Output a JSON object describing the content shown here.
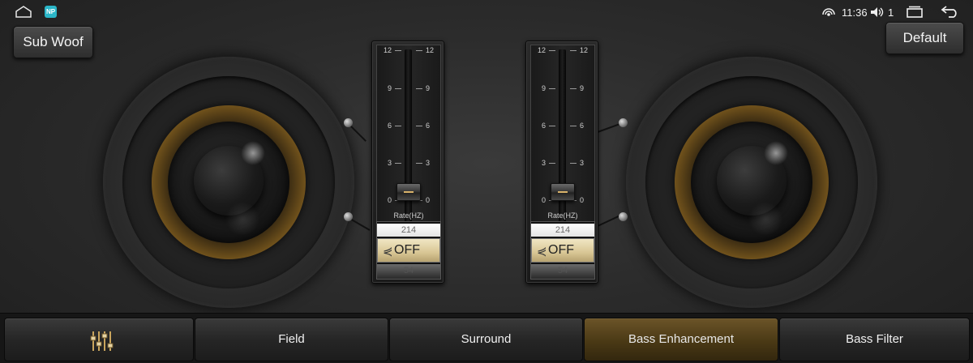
{
  "status_bar": {
    "time": "11:36",
    "volume_level": "1",
    "icons": [
      "home-icon",
      "app-icon",
      "hotspot-icon",
      "volume-icon",
      "recent-apps-icon",
      "back-icon"
    ],
    "app_icon_text": "NP"
  },
  "buttons": {
    "sub_woof": "Sub Woof",
    "default": "Default"
  },
  "sliders": [
    {
      "ticks": [
        "12",
        "9",
        "6",
        "3",
        "0"
      ],
      "value": 0,
      "rate_label": "Rate(HZ)",
      "roller_above": "214",
      "roller_selected": "OFF",
      "roller_below": "54"
    },
    {
      "ticks": [
        "12",
        "9",
        "6",
        "3",
        "0"
      ],
      "value": 0,
      "rate_label": "Rate(HZ)",
      "roller_above": "214",
      "roller_selected": "OFF",
      "roller_below": "54"
    }
  ],
  "tabs": {
    "equalizer_icon": "equalizer-icon",
    "field": "Field",
    "surround": "Surround",
    "bass_enhancement": "Bass Enhancement",
    "bass_filter": "Bass Filter",
    "active": "bass_enhancement"
  },
  "colors": {
    "accent_gold": "#8a6420",
    "active_tab": "#6b5428",
    "background": "#2c2c2c"
  }
}
